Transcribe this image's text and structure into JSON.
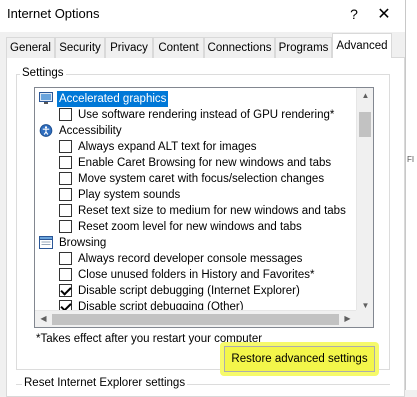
{
  "window": {
    "title": "Internet Options",
    "help_glyph": "?",
    "close_glyph": "✕"
  },
  "background_app": {
    "text_fragment": "FI"
  },
  "tabs": [
    {
      "label": "General"
    },
    {
      "label": "Security"
    },
    {
      "label": "Privacy"
    },
    {
      "label": "Content"
    },
    {
      "label": "Connections"
    },
    {
      "label": "Programs"
    },
    {
      "label": "Advanced",
      "active": true
    }
  ],
  "settings": {
    "group_label": "Settings",
    "items": [
      {
        "type": "category",
        "icon": "monitor-icon",
        "label": "Accelerated graphics",
        "selected": true
      },
      {
        "type": "checkbox",
        "label": "Use software rendering instead of GPU rendering*",
        "checked": false
      },
      {
        "type": "category",
        "icon": "accessibility-icon",
        "label": "Accessibility"
      },
      {
        "type": "checkbox",
        "label": "Always expand ALT text for images",
        "checked": false
      },
      {
        "type": "checkbox",
        "label": "Enable Caret Browsing for new windows and tabs",
        "checked": false
      },
      {
        "type": "checkbox",
        "label": "Move system caret with focus/selection changes",
        "checked": false
      },
      {
        "type": "checkbox",
        "label": "Play system sounds",
        "checked": false
      },
      {
        "type": "checkbox",
        "label": "Reset text size to medium for new windows and tabs",
        "checked": false
      },
      {
        "type": "checkbox",
        "label": "Reset zoom level for new windows and tabs",
        "checked": false
      },
      {
        "type": "category",
        "icon": "browsing-icon",
        "label": "Browsing"
      },
      {
        "type": "checkbox",
        "label": "Always record developer console messages",
        "checked": false
      },
      {
        "type": "checkbox",
        "label": "Close unused folders in History and Favorites*",
        "checked": false
      },
      {
        "type": "checkbox",
        "label": "Disable script debugging (Internet Explorer)",
        "checked": true
      },
      {
        "type": "checkbox",
        "label": "Disable script debugging (Other)",
        "checked": true
      }
    ]
  },
  "note": "*Takes effect after you restart your computer",
  "restore_button": "Restore advanced settings",
  "reset_section_label": "Reset Internet Explorer settings",
  "colors": {
    "selection": "#0078d7",
    "highlighter": "#f3f64a"
  }
}
